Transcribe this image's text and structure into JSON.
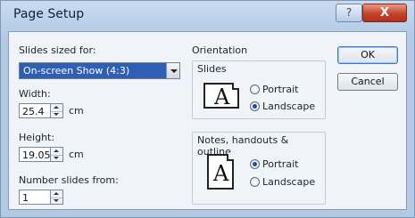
{
  "window": {
    "title": "Page Setup",
    "help_glyph": "?",
    "close_glyph": "X"
  },
  "slides_sized_for": {
    "label": "Slides sized for:",
    "selected": "On-screen Show (4:3)"
  },
  "width": {
    "label": "Width:",
    "value": "25.4",
    "unit": "cm"
  },
  "height": {
    "label": "Height:",
    "value": "19.05",
    "unit": "cm"
  },
  "number_from": {
    "label": "Number slides from:",
    "value": "1"
  },
  "orientation": {
    "title": "Orientation",
    "slides": {
      "title": "Slides",
      "icon_letter": "A",
      "options": [
        {
          "label": "Portrait",
          "selected": false
        },
        {
          "label": "Landscape",
          "selected": true
        }
      ]
    },
    "notes": {
      "title": "Notes, handouts & outline",
      "icon_letter": "A",
      "options": [
        {
          "label": "Portrait",
          "selected": true
        },
        {
          "label": "Landscape",
          "selected": false
        }
      ]
    }
  },
  "buttons": {
    "ok": "OK",
    "cancel": "Cancel"
  },
  "icons": {
    "help": "help-icon",
    "close": "close-icon",
    "dropdown": "chevron-down-icon",
    "spin_up": "spin-up-icon",
    "spin_down": "spin-down-icon",
    "page_landscape": "landscape-page-icon",
    "page_portrait": "portrait-page-icon"
  }
}
